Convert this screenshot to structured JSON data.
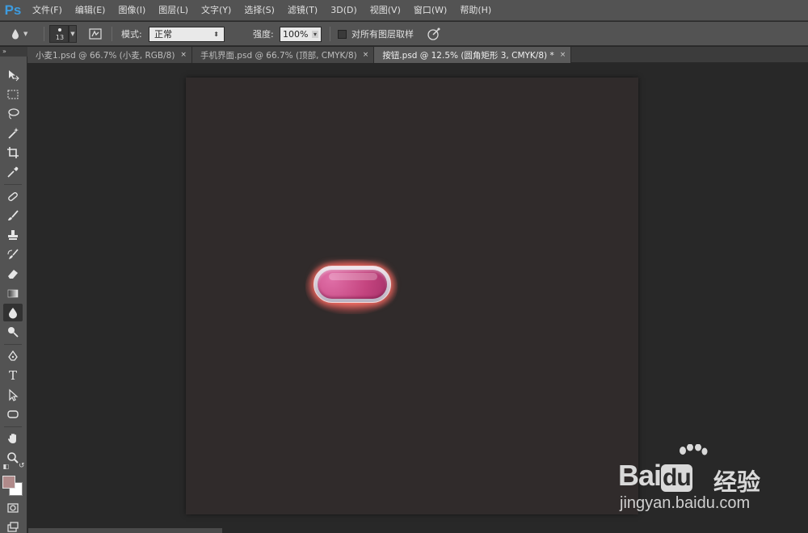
{
  "app": {
    "logo": "Ps"
  },
  "menu": [
    "文件(F)",
    "编辑(E)",
    "图像(I)",
    "图层(L)",
    "文字(Y)",
    "选择(S)",
    "滤镜(T)",
    "3D(D)",
    "视图(V)",
    "窗口(W)",
    "帮助(H)"
  ],
  "options": {
    "brush_size": "13",
    "mode_label": "模式:",
    "mode_value": "正常",
    "strength_label": "强度:",
    "strength_value": "100%",
    "sample_all_layers": "对所有图层取样",
    "sample_all_layers_checked": false
  },
  "panel_strip": "»",
  "tabs": [
    {
      "label": "小麦1.psd @ 66.7% (小麦, RGB/8)",
      "close": "×",
      "active": false
    },
    {
      "label": "手机界面.psd @ 66.7% (顶部, CMYK/8)",
      "close": "×",
      "active": false
    },
    {
      "label": "按钮.psd @ 12.5% (圆角矩形 3, CMYK/8) *",
      "close": "×",
      "active": true
    }
  ],
  "tools": [
    "move-tool",
    "marquee-tool",
    "lasso-tool",
    "magic-wand-tool",
    "crop-tool",
    "eyedropper-tool",
    "spot-healing-tool",
    "brush-tool",
    "clone-stamp-tool",
    "history-brush-tool",
    "eraser-tool",
    "gradient-tool",
    "blur-tool",
    "dodge-tool",
    "pen-tool",
    "type-tool",
    "path-selection-tool",
    "shape-tool",
    "hand-tool",
    "zoom-tool"
  ],
  "type_tool_glyph": "T",
  "colors": {
    "foreground": "#b08a8a",
    "background": "#ffffff",
    "pill_fill": "#c4447f",
    "glow": "#ff7a6e"
  },
  "watermark": {
    "brand_a": "Bai",
    "brand_b": "du",
    "brand_cn": "经验",
    "url": "jingyan.baidu.com"
  }
}
